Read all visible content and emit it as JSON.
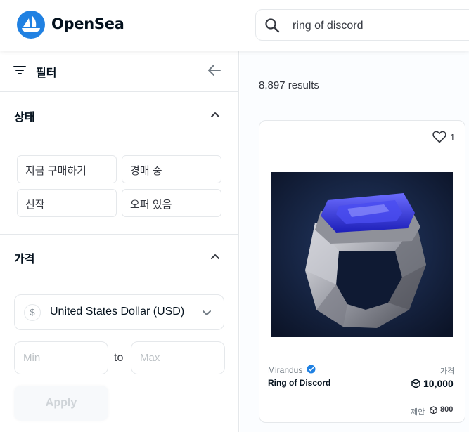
{
  "header": {
    "brand": "OpenSea",
    "logo_icon": "opensea-sailboat-icon",
    "search": {
      "value": "ring of discord",
      "icon": "search-icon"
    }
  },
  "sidebar": {
    "filter_label": "필터",
    "status": {
      "title": "상태",
      "options": [
        "지금 구매하기",
        "경매 중",
        "신작",
        "오퍼 있음"
      ]
    },
    "price": {
      "title": "가격",
      "currency": "United States Dollar (USD)",
      "currency_symbol": "$",
      "min_placeholder": "Min",
      "to": "to",
      "max_placeholder": "Max",
      "apply": "Apply"
    }
  },
  "main": {
    "results": "8,897 results",
    "cards": [
      {
        "favorites": "1",
        "collection": "Mirandus",
        "name": "Ring of Discord",
        "price_caption": "가격",
        "price": "10,000",
        "offer_caption": "제안",
        "offer": "800"
      }
    ]
  },
  "colors": {
    "brand_blue": "#2081e2",
    "text_primary": "#04111d",
    "text_secondary": "#707a83",
    "border": "#e5e8eb",
    "gem_blue": "#2b2fd6"
  }
}
